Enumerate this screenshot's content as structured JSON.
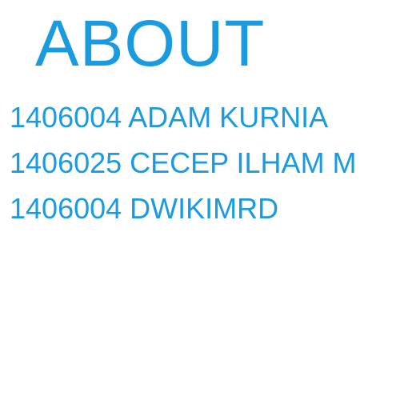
{
  "page": {
    "title": "ABOUT",
    "accent_color": "#1a9be0",
    "background_color": "#ffffff"
  },
  "members": [
    {
      "text": "1406004 ADAM KURNIA"
    },
    {
      "text": "1406025 CECEP ILHAM M"
    },
    {
      "text": "1406004 DWIKIMRD"
    }
  ]
}
